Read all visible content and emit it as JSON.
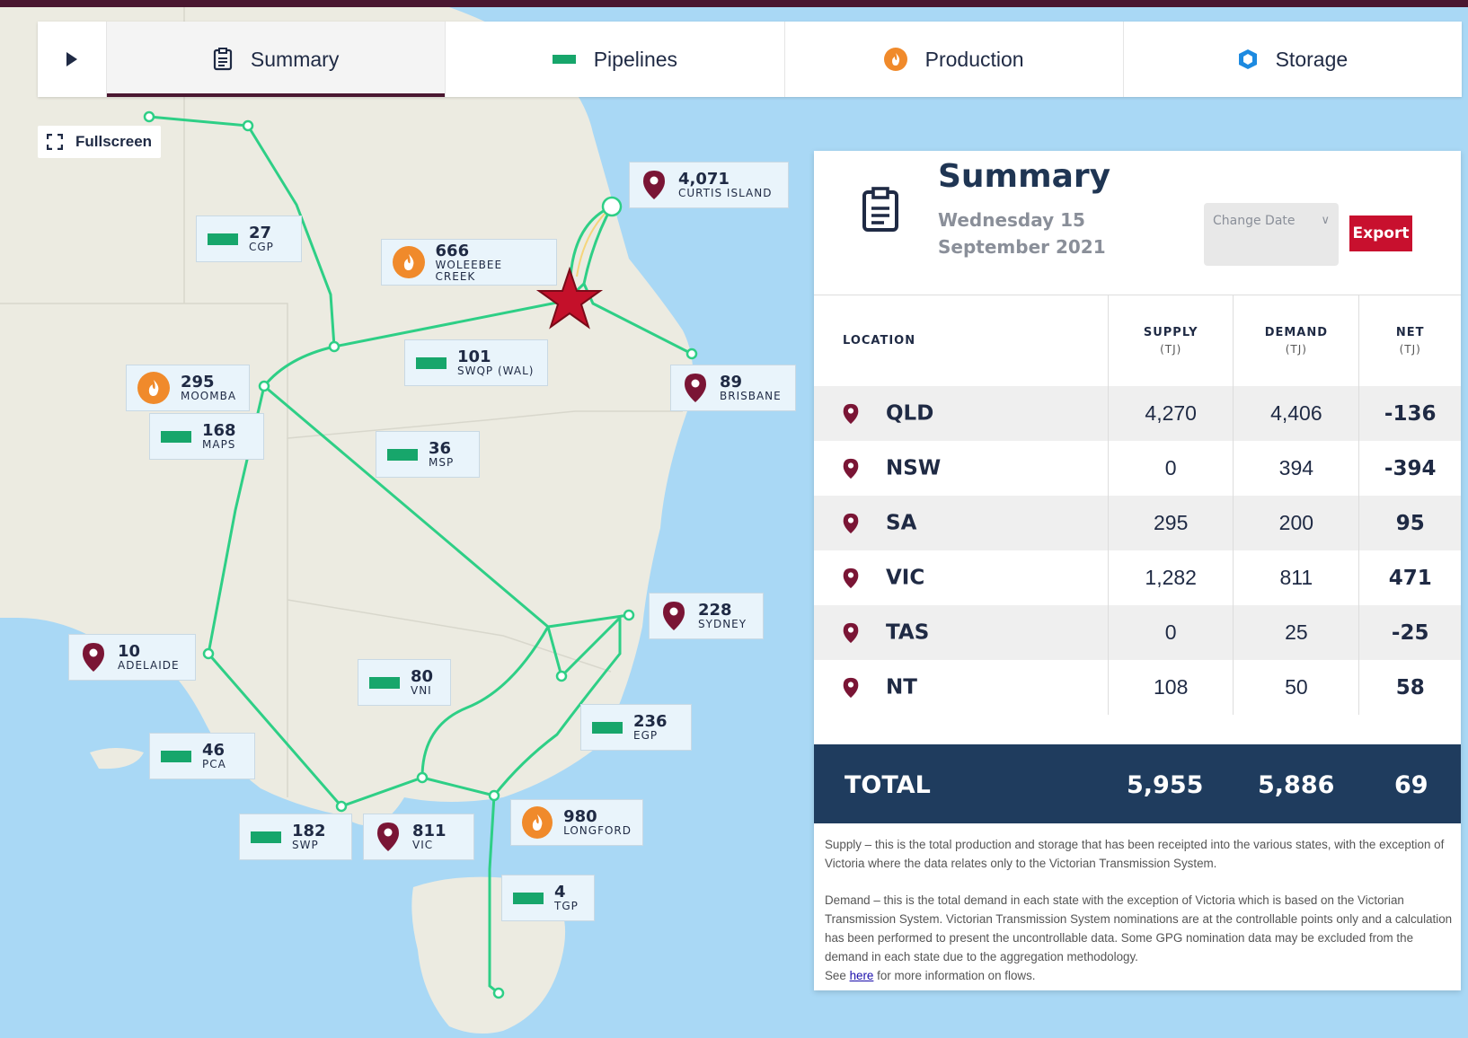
{
  "tabs": [
    {
      "label": "Summary",
      "icon": "clipboard-icon",
      "active": true
    },
    {
      "label": "Pipelines",
      "icon": "pipeline-icon",
      "active": false
    },
    {
      "label": "Production",
      "icon": "flame-icon",
      "active": false
    },
    {
      "label": "Storage",
      "icon": "storage-icon",
      "active": false
    }
  ],
  "fullscreen_label": "Fullscreen",
  "map_labels": {
    "curtis_island": {
      "value": "4,071",
      "name": "CURTIS ISLAND",
      "type": "location"
    },
    "cgp": {
      "value": "27",
      "name": "CGP",
      "type": "pipeline"
    },
    "woleebee_creek": {
      "value": "666",
      "name": "WOLEEBEE CREEK",
      "type": "production"
    },
    "swqp": {
      "value": "101",
      "name": "SWQP (WAL)",
      "type": "pipeline"
    },
    "brisbane": {
      "value": "89",
      "name": "BRISBANE",
      "type": "location"
    },
    "moomba": {
      "value": "295",
      "name": "MOOMBA",
      "type": "production"
    },
    "maps": {
      "value": "168",
      "name": "MAPS",
      "type": "pipeline"
    },
    "msp": {
      "value": "36",
      "name": "MSP",
      "type": "pipeline"
    },
    "sydney": {
      "value": "228",
      "name": "SYDNEY",
      "type": "location"
    },
    "adelaide": {
      "value": "10",
      "name": "ADELAIDE",
      "type": "location"
    },
    "vni": {
      "value": "80",
      "name": "VNI",
      "type": "pipeline"
    },
    "egp": {
      "value": "236",
      "name": "EGP",
      "type": "pipeline"
    },
    "pca": {
      "value": "46",
      "name": "PCA",
      "type": "pipeline"
    },
    "swp": {
      "value": "182",
      "name": "SWP",
      "type": "pipeline"
    },
    "vic": {
      "value": "811",
      "name": "VIC",
      "type": "location"
    },
    "longford": {
      "value": "980",
      "name": "LONGFORD",
      "type": "production"
    },
    "tgp": {
      "value": "4",
      "name": "TGP",
      "type": "pipeline"
    }
  },
  "summary": {
    "title": "Summary",
    "date": "Wednesday 15 September 2021",
    "change_date_label": "Change Date",
    "export_label": "Export",
    "columns": {
      "location": "LOCATION",
      "supply": "SUPPLY",
      "demand": "DEMAND",
      "net": "NET",
      "unit": "(TJ)"
    },
    "rows": [
      {
        "state": "QLD",
        "supply": "4,270",
        "demand": "4,406",
        "net": "-136"
      },
      {
        "state": "NSW",
        "supply": "0",
        "demand": "394",
        "net": "-394"
      },
      {
        "state": "SA",
        "supply": "295",
        "demand": "200",
        "net": "95"
      },
      {
        "state": "VIC",
        "supply": "1,282",
        "demand": "811",
        "net": "471"
      },
      {
        "state": "TAS",
        "supply": "0",
        "demand": "25",
        "net": "-25"
      },
      {
        "state": "NT",
        "supply": "108",
        "demand": "50",
        "net": "58"
      }
    ],
    "total": {
      "label": "TOTAL",
      "supply": "5,955",
      "demand": "5,886",
      "net": "69"
    },
    "notes": {
      "supply": "Supply – this is the total production and storage that has been receipted into the various states, with the exception of Victoria where the data relates only to the Victorian Transmission System.",
      "demand": "Demand – this is the total demand in each state with the exception of Victoria which is based on the Victorian Transmission System. Victorian Transmission System nominations are at the controllable points only and a calculation has been performed to present the uncontrollable data. Some GPG nomination data may be excluded from the demand in each state due to the aggregation methodology.",
      "see_prefix": "See",
      "see_link": "here",
      "see_suffix": "for more information on flows."
    }
  },
  "colors": {
    "brand": "#4a1730",
    "pipeline": "#2ecf86",
    "production": "#f08a2b",
    "location_pin": "#7a1535",
    "export": "#c8102e",
    "total_bar": "#1f3c5e",
    "sea": "#a9d8f5",
    "land": "#ecebe1"
  }
}
